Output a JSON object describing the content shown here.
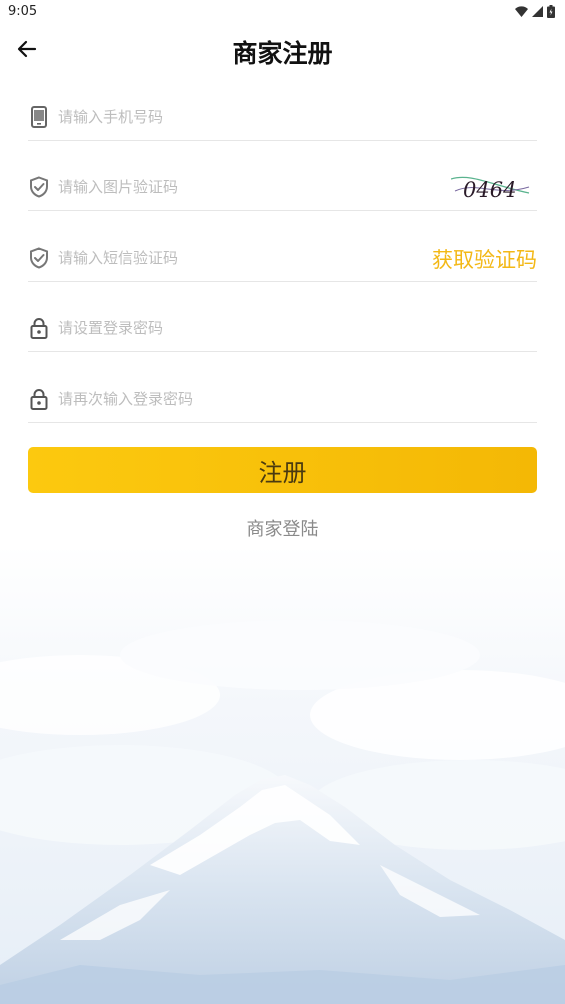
{
  "status_bar": {
    "time": "9:05",
    "icons": [
      "wifi-icon",
      "cellular-signal-icon",
      "battery-icon"
    ]
  },
  "header": {
    "title": "商家注册",
    "back_icon": "arrow-left-icon"
  },
  "form": {
    "phone_placeholder": "请输入手机号码",
    "captcha_placeholder": "请输入图片验证码",
    "captcha_text": "0464",
    "sms_placeholder": "请输入短信验证码",
    "sms_button": "获取验证码",
    "password_placeholder": "请设置登录密码",
    "password_confirm_placeholder": "请再次输入登录密码"
  },
  "actions": {
    "register_label": "注册",
    "login_label": "商家登陆"
  },
  "colors": {
    "accent": "#f3b816",
    "button_gradient_start": "#fcc90f",
    "button_gradient_end": "#f4b805",
    "placeholder": "#bdbdbd",
    "divider": "#e6e6e6"
  }
}
